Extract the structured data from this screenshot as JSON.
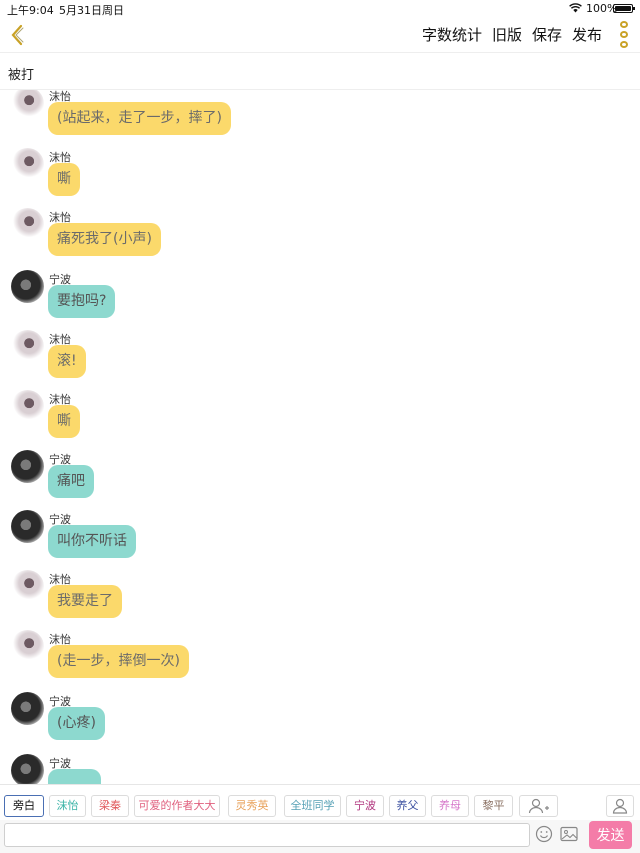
{
  "status_bar": {
    "time": "上午9:04",
    "date": "5月31日周日",
    "battery": "100%"
  },
  "nav": {
    "word_count": "字数统计",
    "old_version": "旧版",
    "save": "保存",
    "publish": "发布"
  },
  "chat": {
    "title": "被打",
    "messages": [
      {
        "sender": "沫怡",
        "text": "(站起来，走了一步，摔了)",
        "color": "yellow"
      },
      {
        "sender": "沫怡",
        "text": "嘶",
        "color": "yellow"
      },
      {
        "sender": "沫怡",
        "text": "痛死我了(小声)",
        "color": "yellow"
      },
      {
        "sender": "宁波",
        "text": "要抱吗?",
        "color": "teal"
      },
      {
        "sender": "沫怡",
        "text": "滚!",
        "color": "yellow"
      },
      {
        "sender": "沫怡",
        "text": "嘶",
        "color": "yellow"
      },
      {
        "sender": "宁波",
        "text": "痛吧",
        "color": "teal"
      },
      {
        "sender": "宁波",
        "text": "叫你不听话",
        "color": "teal"
      },
      {
        "sender": "沫怡",
        "text": "我要走了",
        "color": "yellow"
      },
      {
        "sender": "沫怡",
        "text": "(走一步，摔倒一次)",
        "color": "yellow"
      },
      {
        "sender": "宁波",
        "text": "(心疼)",
        "color": "teal"
      },
      {
        "sender": "宁波",
        "text": "",
        "color": "teal"
      }
    ]
  },
  "roles": [
    {
      "name": "旁白",
      "color": "#111111"
    },
    {
      "name": "沫怡",
      "color": "#38b3a6"
    },
    {
      "name": "梁秦",
      "color": "#e0575a"
    },
    {
      "name": "可爱的作者大大",
      "color": "#e0607e"
    },
    {
      "name": "灵秀英",
      "color": "#e8a15a"
    },
    {
      "name": "全班同学",
      "color": "#55a0b5"
    },
    {
      "name": "宁波",
      "color": "#b0347d"
    },
    {
      "name": "养父",
      "color": "#3a4fa0"
    },
    {
      "name": "养母",
      "color": "#d676c9"
    },
    {
      "name": "黎平",
      "color": "#8a7062"
    }
  ],
  "input": {
    "placeholder": "",
    "send_label": "发送"
  },
  "colors": {
    "accent": "#c9a227",
    "bubble_yellow": "#fbd96b",
    "bubble_teal": "#8dd9cf",
    "send": "#f47ca8"
  },
  "icons": {
    "back": "chevron-left-icon",
    "more": "more-vertical-icon",
    "add_role": "add-person-icon",
    "profile": "person-icon",
    "emoji": "smiley-icon",
    "image": "image-icon"
  }
}
